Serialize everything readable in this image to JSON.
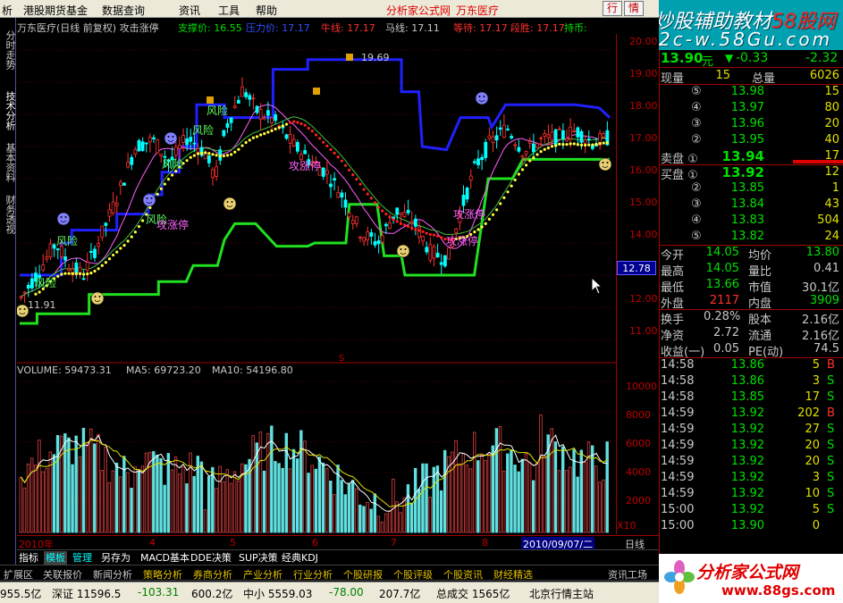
{
  "menu": {
    "items": [
      "析",
      "港股期货基金",
      "数据查询",
      "资讯",
      "工具",
      "帮助"
    ],
    "promo1": "分析家公式网",
    "promo2": "万东医疗",
    "side_buttons": [
      "行",
      "情"
    ]
  },
  "left_tabs": [
    "分时走势",
    "技术分析",
    "基本资料",
    "财务透视"
  ],
  "title_row": {
    "stock": "万东医疗(日线 前复权) 攻击涨停",
    "support": "支撑价: 16.55",
    "fuzzy1": "压力价: 17.17",
    "niu": "牛线: 17.17",
    "ma": "马线: 17.11",
    "dengting": "等待: 17.17",
    "fuzzy2": "段胜: 17.17",
    "hold": "持币:"
  },
  "price_axis": [
    "20.00",
    "19.00",
    "18.00",
    "17.00",
    "16.00",
    "15.00",
    "14.00",
    "13.00",
    "12.00",
    "11.00"
  ],
  "current_price_marker": "12.78",
  "annotations": {
    "high": "19.69",
    "low": "11.91",
    "fengxian": "风险",
    "gongji": "攻涨停",
    "marker_s": "S"
  },
  "volume": {
    "label": "VOLUME: 59473.31",
    "ma5": "MA5: 69723.20",
    "ma10": "MA10: 54196.80",
    "axis": [
      "10000",
      "8000",
      "6000",
      "4000",
      "2000"
    ],
    "unit": "X10"
  },
  "date_axis": {
    "labels": [
      "2010年",
      "4",
      "5",
      "6",
      "7",
      "8"
    ],
    "selected": "2010/09/07/二",
    "period": "日线"
  },
  "tabs": [
    "指标",
    "模板",
    "管理",
    "另存为",
    "MACD基本",
    "DDE决策",
    "SUP决策",
    "经典KDJ"
  ],
  "bottom_links": [
    "扩展区",
    "关联报价",
    "新闻分析",
    "策略分析",
    "券商分析",
    "产业分析",
    "行业分析",
    "个股研报",
    "个股评级",
    "个股资讯",
    "财经精选",
    "资讯工场"
  ],
  "status": {
    "s1": "955.5亿",
    "s2": "深证 11596.5",
    "s3": "-103.31",
    "s4": "600.2亿",
    "s5": "中小 5559.03",
    "s6": "-78.00",
    "s7": "207.7亿",
    "s8": "总成交 1565亿",
    "s9": "北京行情主站"
  },
  "watermark": {
    "line1": "炒股辅助教材",
    "line1b": "58股网",
    "line2": "2c-w.58Gu.com"
  },
  "quote": {
    "price": "13.90",
    "unit": "元",
    "arrow": "▼",
    "change": "-0.33",
    "pct": "-2.32",
    "xianliang_label": "现量",
    "xianliang": "15",
    "zongliang_label": "总量",
    "zongliang": "6026"
  },
  "asks": [
    {
      "lvl": "⑤",
      "price": "13.98",
      "vol": "15"
    },
    {
      "lvl": "④",
      "price": "13.97",
      "vol": "80"
    },
    {
      "lvl": "③",
      "price": "13.96",
      "vol": "20"
    },
    {
      "lvl": "②",
      "price": "13.95",
      "vol": "40"
    },
    {
      "lvl": "卖盘 ①",
      "price": "13.94",
      "vol": "17"
    }
  ],
  "bids": [
    {
      "lvl": "买盘 ①",
      "price": "13.92",
      "vol": "12"
    },
    {
      "lvl": "②",
      "price": "13.85",
      "vol": "1"
    },
    {
      "lvl": "③",
      "price": "13.84",
      "vol": "43"
    },
    {
      "lvl": "④",
      "price": "13.83",
      "vol": "504"
    },
    {
      "lvl": "⑤",
      "price": "13.82",
      "vol": "24"
    }
  ],
  "stats": [
    {
      "l1": "今开",
      "v1": "14.05",
      "l2": "均价",
      "v2": "13.80"
    },
    {
      "l1": "最高",
      "v1": "14.05",
      "l2": "量比",
      "v2": "0.41"
    },
    {
      "l1": "最低",
      "v1": "13.66",
      "l2": "市值",
      "v2": "30.1亿"
    },
    {
      "l1": "外盘",
      "v1": "2117",
      "l2": "内盘",
      "v2": "3909"
    },
    {
      "l1": "换手",
      "v1": "0.28%",
      "l2": "股本",
      "v2": "2.16亿"
    },
    {
      "l1": "净资",
      "v1": "2.72",
      "l2": "流通",
      "v2": "2.16亿"
    },
    {
      "l1": "收益(一)",
      "v1": "0.05",
      "l2": "PE(动)",
      "v2": "74.5"
    }
  ],
  "ticks": [
    {
      "time": "14:58",
      "price": "13.86",
      "vol": "5",
      "side": "B"
    },
    {
      "time": "14:58",
      "price": "13.86",
      "vol": "3",
      "side": "S"
    },
    {
      "time": "14:58",
      "price": "13.85",
      "vol": "17",
      "side": "S"
    },
    {
      "time": "14:59",
      "price": "13.92",
      "vol": "202",
      "side": "B"
    },
    {
      "time": "14:59",
      "price": "13.92",
      "vol": "27",
      "side": "S"
    },
    {
      "time": "14:59",
      "price": "13.92",
      "vol": "20",
      "side": "S"
    },
    {
      "time": "14:59",
      "price": "13.92",
      "vol": "20",
      "side": "S"
    },
    {
      "time": "14:59",
      "price": "13.92",
      "vol": "3",
      "side": "S"
    },
    {
      "time": "14:59",
      "price": "13.92",
      "vol": "10",
      "side": "S"
    },
    {
      "time": "15:00",
      "price": "13.92",
      "vol": "5",
      "side": "S"
    },
    {
      "time": "15:00",
      "price": "13.90",
      "vol": "0",
      "side": ""
    }
  ],
  "logo": {
    "title": "分析家公式网",
    "url": "www.88gs.com"
  }
}
